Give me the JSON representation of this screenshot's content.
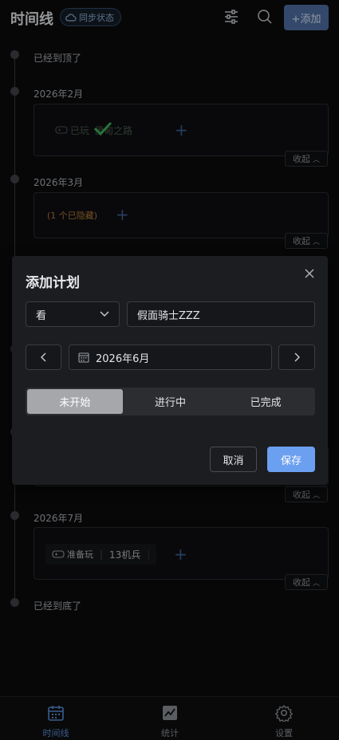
{
  "header": {
    "title": "时间线",
    "sync_label": "同步状态",
    "add_label": "+添加"
  },
  "timeline": {
    "top_text": "已经到顶了",
    "bottom_text": "已经到底了",
    "collapse_label": "收起",
    "groups": [
      {
        "month": "2026年2月",
        "item_status": "已玩",
        "item_title": "伊甸之路"
      },
      {
        "month": "2026年3月",
        "hidden_text": "(1 个已隐藏)"
      },
      {
        "month": "2026年7月",
        "item_status": "准备玩",
        "item_title": "13机兵"
      }
    ]
  },
  "dialog": {
    "title": "添加计划",
    "type_value": "看",
    "name_value": "假面骑士ZZZ",
    "date_value": "2026年6月",
    "status_options": [
      "未开始",
      "进行中",
      "已完成"
    ],
    "status_selected": "未开始",
    "cancel_label": "取消",
    "save_label": "保存"
  },
  "bottom_nav": {
    "items": [
      {
        "label": "时间线",
        "icon": "calendar-icon",
        "active": true
      },
      {
        "label": "统计",
        "icon": "chart-icon",
        "active": false
      },
      {
        "label": "设置",
        "icon": "gear-icon",
        "active": false
      }
    ]
  },
  "colors": {
    "accent": "#5a8fd6",
    "save_button": "#6b9ff0",
    "hidden_text": "#b47a3a",
    "played_check": "#3fae5a"
  }
}
